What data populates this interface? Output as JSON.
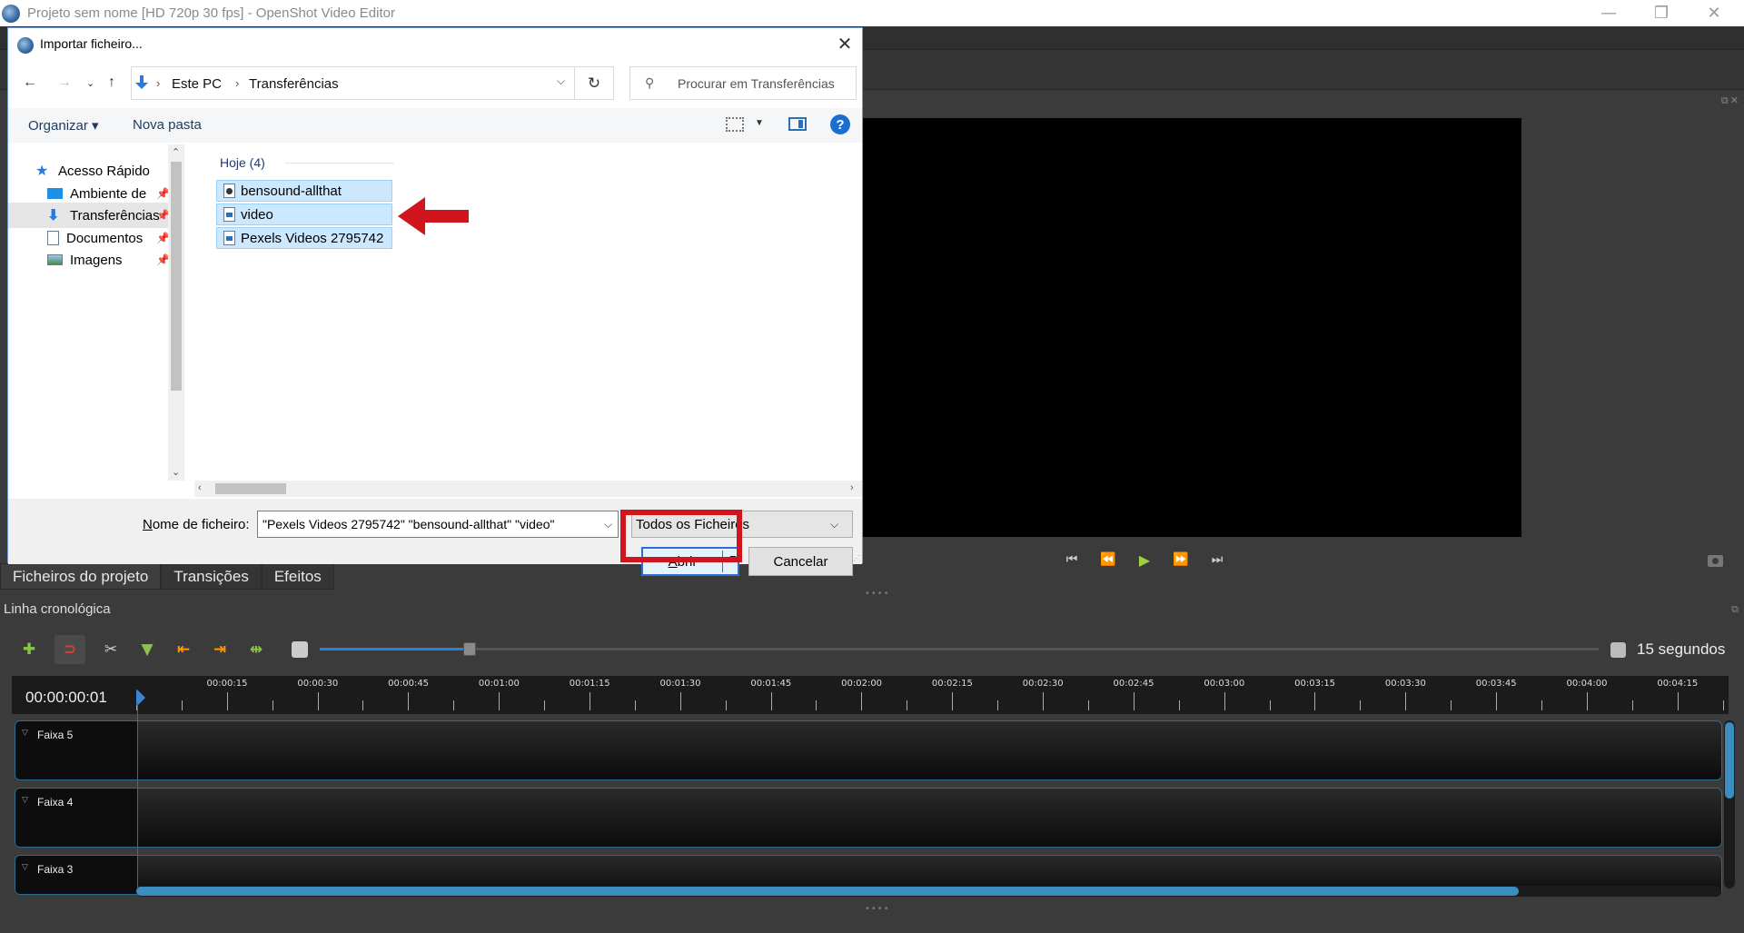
{
  "window": {
    "title": "Projeto sem nome [HD 720p 30 fps] - OpenShot Video Editor",
    "minimize_glyph": "—",
    "maximize_glyph": "❐",
    "close_glyph": "✕"
  },
  "main": {
    "tabs": [
      {
        "label": "Ficheiros do projeto"
      },
      {
        "label": "Transições"
      },
      {
        "label": "Efeitos"
      }
    ],
    "timeline_label": "Linha cronológica",
    "zoom_value": "15 segundos",
    "zoom_fraction": 0.115,
    "timecode": "00:00:00:01",
    "ruler_labels": [
      "00:00:15",
      "00:00:30",
      "00:00:45",
      "00:01:00",
      "00:01:15",
      "00:01:30",
      "00:01:45",
      "00:02:00",
      "00:02:15",
      "00:02:30",
      "00:02:45",
      "00:03:00",
      "00:03:15",
      "00:03:30",
      "00:03:45",
      "00:04:00",
      "00:04:15"
    ],
    "tracks": [
      {
        "name": "Faixa 5"
      },
      {
        "name": "Faixa 4"
      },
      {
        "name": "Faixa 3"
      }
    ],
    "preview_controls": [
      "⏮",
      "⏪",
      "▶",
      "⏩",
      "⏭"
    ],
    "timeline_tools": [
      {
        "name": "add-track-icon",
        "glyph": "✚",
        "color": "#8bc34a"
      },
      {
        "name": "snap-magnet-icon",
        "glyph": "⊃",
        "color": "#e53935"
      },
      {
        "name": "razor-scissors-icon",
        "glyph": "✂",
        "color": "#cfcfcf"
      },
      {
        "name": "add-marker-icon",
        "glyph": "▼",
        "color": "#8bc34a"
      },
      {
        "name": "previous-marker-icon",
        "glyph": "⇤",
        "color": "#ff9800"
      },
      {
        "name": "next-marker-icon",
        "glyph": "⇥",
        "color": "#ff9800"
      },
      {
        "name": "center-playhead-icon",
        "glyph": "⇹",
        "color": "#8bc34a"
      }
    ]
  },
  "dialog": {
    "title": "Importar ficheiro...",
    "breadcrumb": [
      "Este PC",
      "Transferências"
    ],
    "search_placeholder": "Procurar em Transferências",
    "organize_label": "Organizar ▾",
    "new_folder_label": "Nova pasta",
    "help_glyph": "?",
    "nav_items": [
      {
        "label": "Acesso Rápido",
        "icon": "star-icon",
        "pinned": false
      },
      {
        "label": "Ambiente de",
        "icon": "desktop-icon",
        "pinned": true
      },
      {
        "label": "Transferências",
        "icon": "download-icon",
        "pinned": true
      },
      {
        "label": "Documentos",
        "icon": "documents-icon",
        "pinned": true
      },
      {
        "label": "Imagens",
        "icon": "pictures-icon",
        "pinned": true
      }
    ],
    "group_header": "Hoje (4)",
    "files": [
      {
        "name": "bensound-allthat",
        "type": "audio"
      },
      {
        "name": "video",
        "type": "video"
      },
      {
        "name": "Pexels Videos 2795742",
        "type": "video"
      }
    ],
    "filename_label_prefix": "N",
    "filename_label_rest": "ome de ficheiro:",
    "filename_value": "\"Pexels Videos 2795742\" \"bensound-allthat\" \"video\"",
    "filetype_value": "Todos os Ficheiros",
    "open_label_prefix": "A",
    "open_label_rest": "brir",
    "cancel_label": "Cancelar"
  },
  "colors": {
    "annotation_red": "#d0161c",
    "accent_blue": "#2a82da"
  }
}
